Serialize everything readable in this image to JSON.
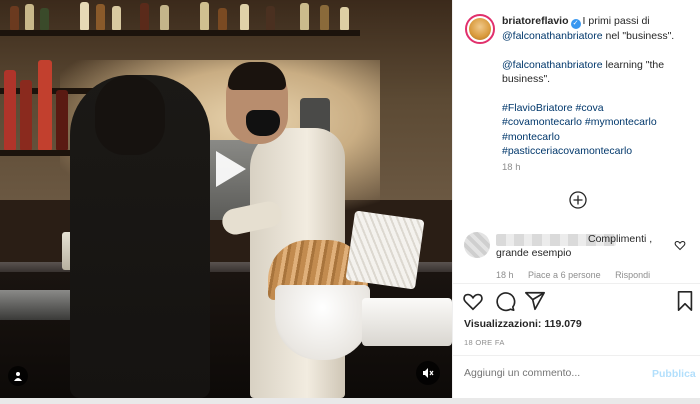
{
  "post": {
    "username": "briatoreflavio",
    "caption_line1_rest": "I primi passi di",
    "mention": "@falconathanbriatore",
    "caption_line2_rest": "nel \"business\".",
    "para2_mention": "@falconathanbriatore",
    "para2_rest": "learning \"the business\".",
    "hashtags": [
      "#FlavioBriatore #cova",
      "#covamontecarlo #mymontecarlo",
      "#montecarlo",
      "#pasticceriacovamontecarlo"
    ],
    "time": "18 h"
  },
  "comment": {
    "text1": "Complimenti ,",
    "text2": "grande esempio",
    "time": "18 h",
    "likes": "Piace a 6 persone",
    "reply": "Rispondi"
  },
  "stats": {
    "views_label": "Visualizzazioni:",
    "views_value": "119.079",
    "ago": "18 ORE FA"
  },
  "input": {
    "placeholder": "Aggiungi un commento...",
    "publish": "Pubblica"
  },
  "icons": {
    "play": "play-icon",
    "user": "user-tag-icon",
    "mute": "mute-icon",
    "plus": "plus-circle-icon",
    "heart": "heart-icon",
    "comment": "comment-icon",
    "share": "share-icon",
    "save": "bookmark-icon",
    "verified": "verified-badge-icon"
  },
  "colors": {
    "link": "#00376b",
    "verified": "#3897f0",
    "publish": "#b2dffc",
    "muted_text": "#8e8e8e"
  }
}
